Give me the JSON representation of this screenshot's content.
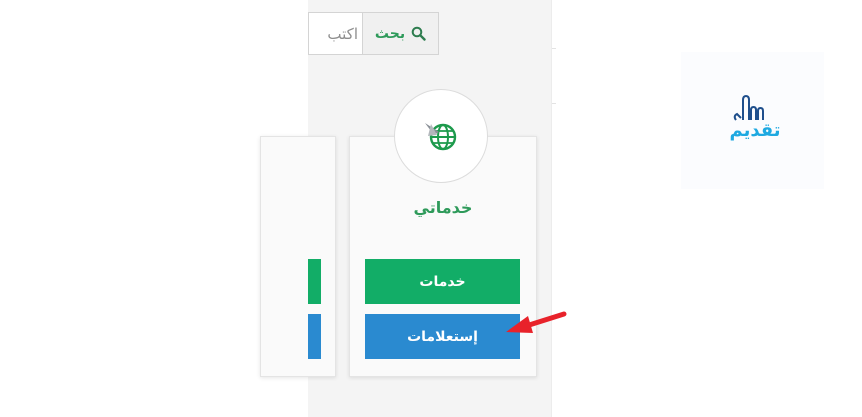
{
  "search": {
    "placeholder": "اكتب",
    "button_label": "بحث",
    "icon": "search-icon"
  },
  "service_card": {
    "title": "خدماتي",
    "icon": "globe-icon",
    "services_button": "خدمات",
    "inquiries_button": "إستعلامات"
  },
  "annotation": {
    "icon": "arrow-icon",
    "color": "#e8222a"
  },
  "logo": {
    "text": "تقديم",
    "icon": "pointing-hand-icon"
  },
  "colors": {
    "green_button": "#12ad67",
    "blue_button": "#2a8ad0",
    "title_green": "#2e9a5a",
    "logo_blue": "#1ea9e1"
  }
}
